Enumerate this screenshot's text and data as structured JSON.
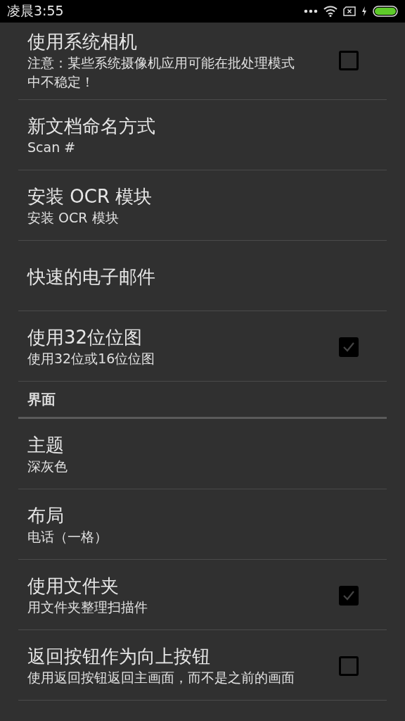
{
  "status_bar": {
    "time": "凌晨3:55"
  },
  "settings": [
    {
      "kind": "checkbox",
      "title": "使用系统相机",
      "summary": "注意：某些系统摄像机应用可能在批处理模式中不稳定！",
      "checked": false
    },
    {
      "kind": "text",
      "title": "新文档命名方式",
      "summary": "Scan #"
    },
    {
      "kind": "text",
      "title": "安装 OCR 模块",
      "summary": "安装 OCR 模块"
    },
    {
      "kind": "text",
      "title": "快速的电子邮件"
    },
    {
      "kind": "checkbox",
      "title": "使用32位位图",
      "summary": "使用32位或16位位图",
      "checked": true
    },
    {
      "kind": "category",
      "title": "界面"
    },
    {
      "kind": "text",
      "title": "主题",
      "summary": "深灰色"
    },
    {
      "kind": "text",
      "title": "布局",
      "summary": "电话（一格）"
    },
    {
      "kind": "checkbox",
      "title": "使用文件夹",
      "summary": "用文件夹整理扫描件",
      "checked": true
    },
    {
      "kind": "checkbox",
      "title": "返回按钮作为向上按钮",
      "summary": "使用返回按钮返回主画面，而不是之前的画面",
      "checked": false
    }
  ]
}
